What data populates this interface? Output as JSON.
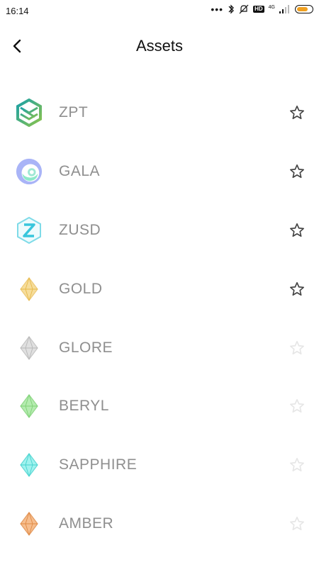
{
  "status_bar": {
    "time": "16:14",
    "network": "4G",
    "hd_label": "HD",
    "battery_color": "#f0a020"
  },
  "header": {
    "title": "Assets",
    "back_icon": "chevron-left-icon"
  },
  "assets": [
    {
      "name": "ZPT",
      "icon": "zpt-logo-icon",
      "starred": true
    },
    {
      "name": "GALA",
      "icon": "gala-logo-icon",
      "starred": true
    },
    {
      "name": "ZUSD",
      "icon": "zusd-logo-icon",
      "starred": true
    },
    {
      "name": "GOLD",
      "icon": "gold-gem-icon",
      "starred": true,
      "gem_color": "#f3d27a"
    },
    {
      "name": "GLORE",
      "icon": "glore-gem-icon",
      "starred": false,
      "gem_color": "#cfcfcf"
    },
    {
      "name": "BERYL",
      "icon": "beryl-gem-icon",
      "starred": false,
      "gem_color": "#9fe39a"
    },
    {
      "name": "SAPPHIRE",
      "icon": "sapphire-gem-icon",
      "starred": false,
      "gem_color": "#7fe7e4"
    },
    {
      "name": "AMBER",
      "icon": "amber-gem-icon",
      "starred": false,
      "gem_color": "#f2a86a"
    }
  ],
  "colors": {
    "star_active": "#444444",
    "star_inactive": "#e6e6e6",
    "asset_text": "#8f8f8f"
  }
}
